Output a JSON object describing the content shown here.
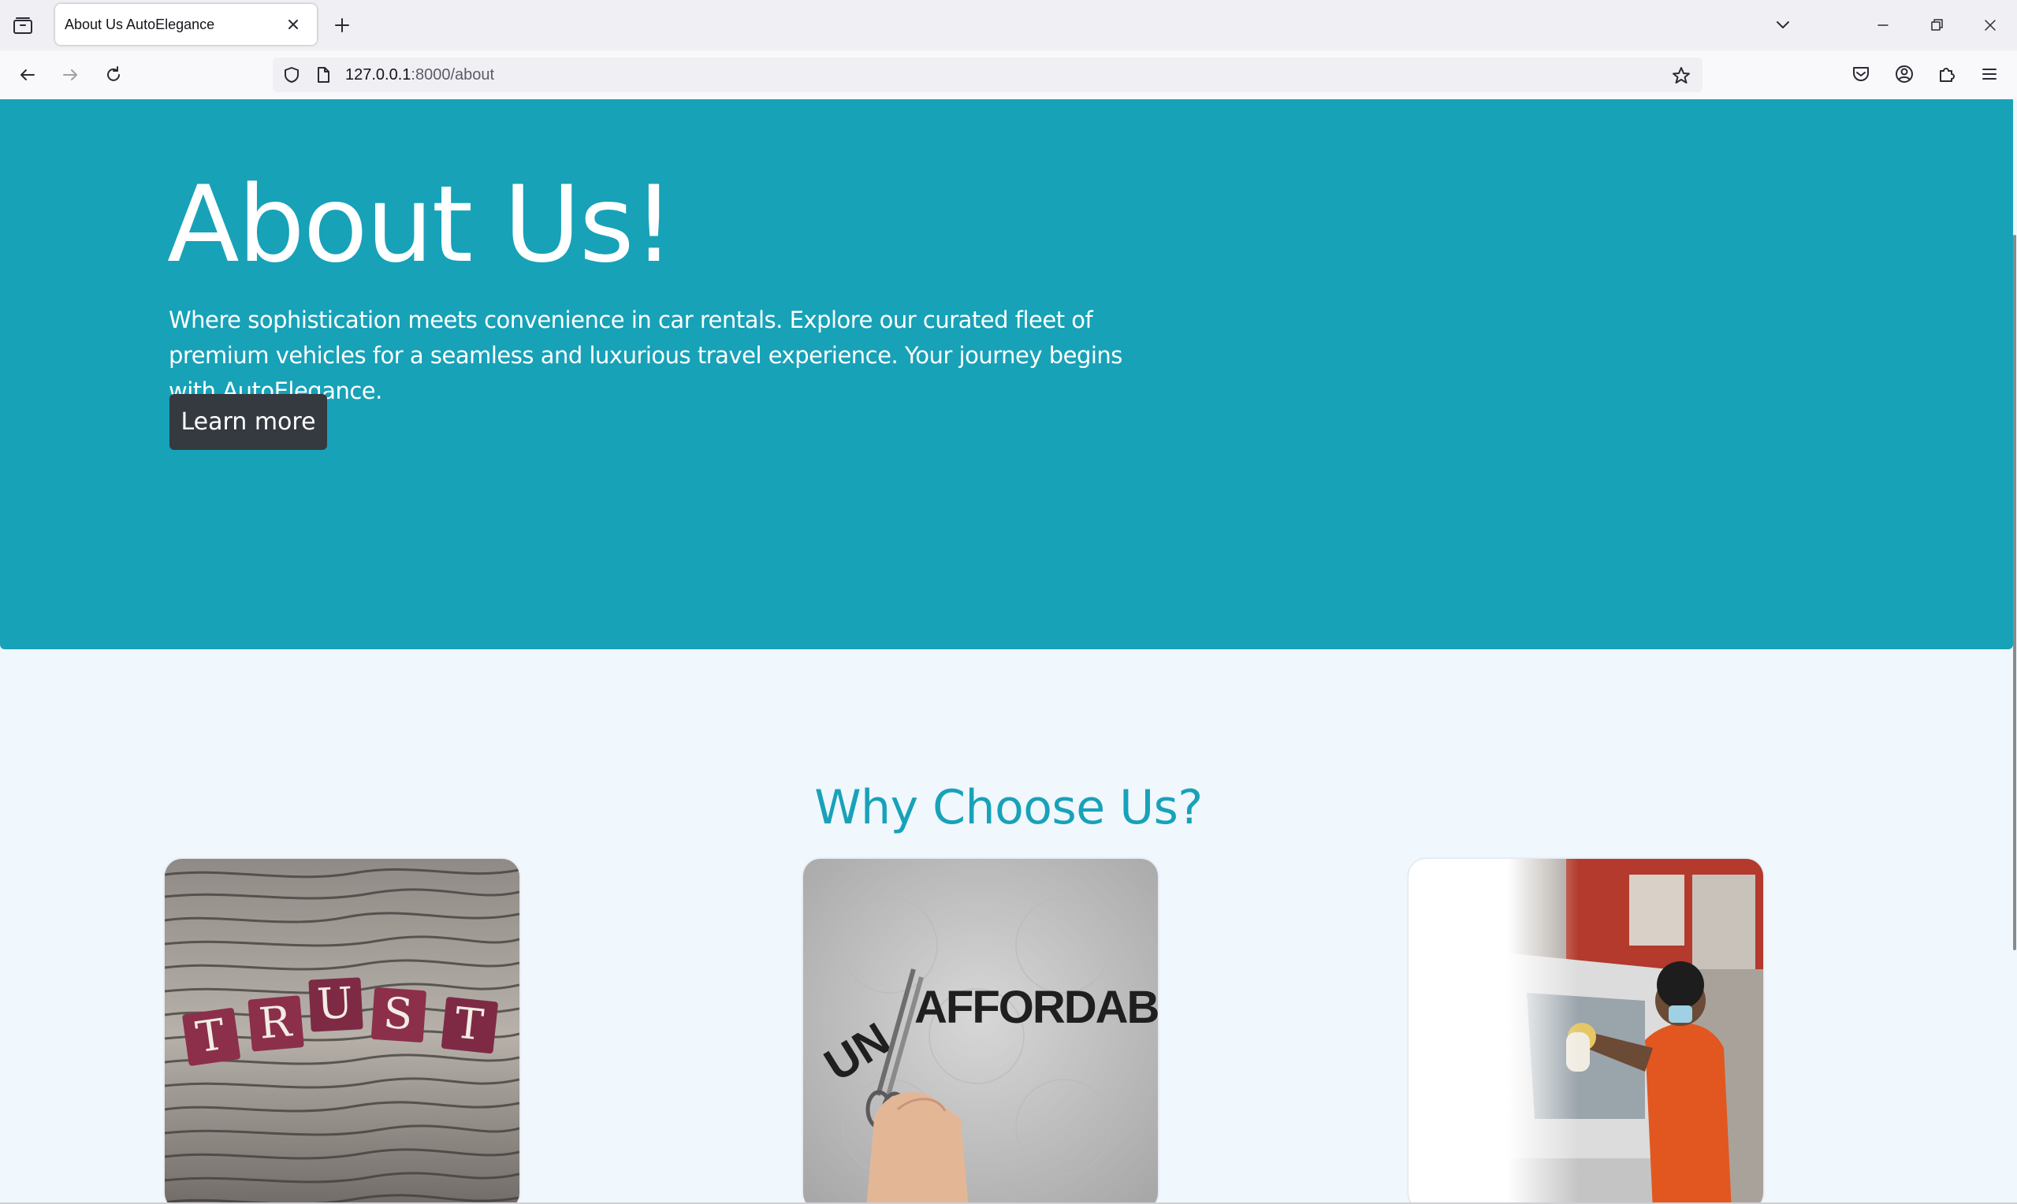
{
  "browser": {
    "tab_title": "About Us AutoElegance",
    "url_host": "127.0.0.1",
    "url_path": ":8000/about"
  },
  "icons": {
    "tab_list": "tab-list-icon",
    "tab_close": "close-icon",
    "new_tab": "plus-icon",
    "back": "arrow-left-icon",
    "forward": "arrow-right-icon",
    "reload": "reload-icon",
    "shield": "shield-icon",
    "page": "page-icon",
    "bookmark": "star-icon",
    "pocket": "pocket-icon",
    "account": "account-icon",
    "extensions": "puzzle-icon",
    "menu": "hamburger-icon"
  },
  "hero": {
    "title": "About Us!",
    "lead": "Where sophistication meets convenience in car rentals. Explore our curated fleet of premium vehicles for a seamless and luxurious travel experience. Your journey begins with AutoElegance.",
    "button_label": "Learn more"
  },
  "why": {
    "title": "Why Choose Us?",
    "cards": [
      {
        "image_text": "TRUST",
        "image": "trust-tiles-image"
      },
      {
        "image_text_cut": "UN",
        "image_text": "AFFORDABLE",
        "image": "affordable-scissors-image"
      },
      {
        "image": "car-service-worker-image"
      }
    ]
  },
  "colors": {
    "hero_bg": "#17a2b8",
    "page_bg": "#f0f7fd",
    "button_bg": "#343a40",
    "accent": "#17a2b8"
  }
}
